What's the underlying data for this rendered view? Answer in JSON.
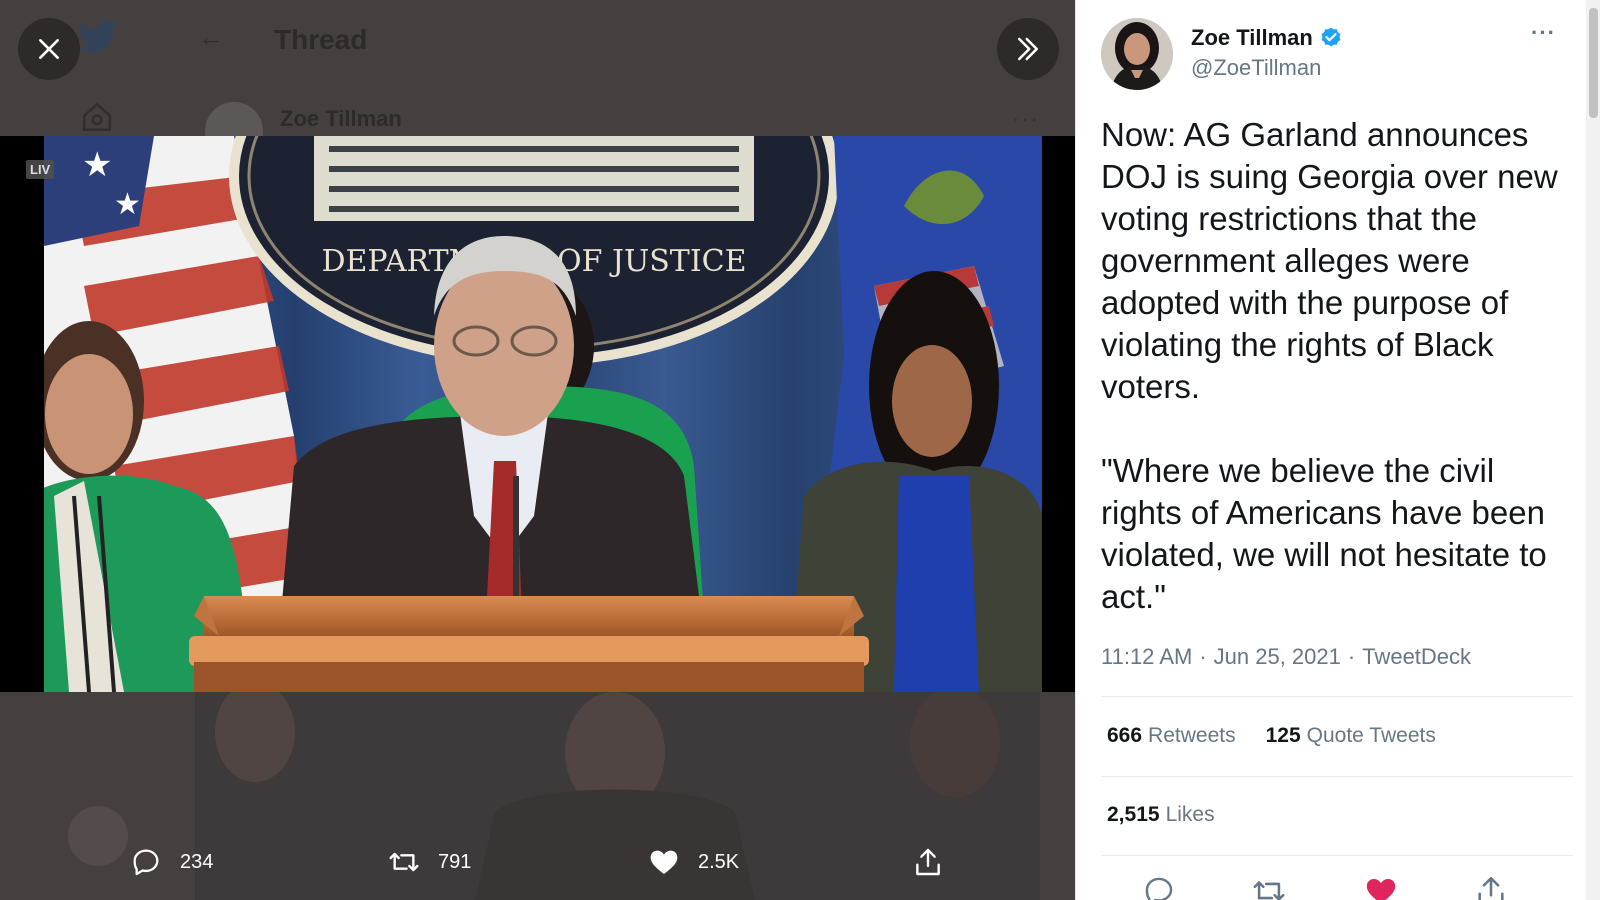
{
  "background_header": {
    "title": "Thread",
    "author_name": "Zoe Tillman"
  },
  "video": {
    "live_label": "LIV",
    "seal_text": "DEPARTMENT OF JUSTICE"
  },
  "media_actions": {
    "reply_count": "234",
    "retweet_count": "791",
    "like_count": "2.5K"
  },
  "tweet": {
    "author_name": "Zoe Tillman",
    "author_handle": "@ZoeTillman",
    "text": "Now: AG Garland announces DOJ is suing Georgia over new voting restrictions that the government alleges were adopted with the purpose of violating the rights of Black voters.\n\n\"Where we believe the civil rights of Americans have been violated, we will not hesitate to act.\"",
    "time": "11:12 AM",
    "date": "Jun 25, 2021",
    "source": "TweetDeck",
    "separator": "·",
    "retweets_count": "666",
    "retweets_label": "Retweets",
    "quote_count": "125",
    "quote_label": "Quote Tweets",
    "likes_count": "2,515",
    "likes_label": "Likes"
  },
  "colors": {
    "viewer_bg": "#463f3f",
    "verified_blue": "#1da1f2",
    "like_red": "#e0245e",
    "muted_text": "#657786"
  },
  "icons": [
    "close-icon",
    "chevrons-right-icon",
    "reply-icon",
    "retweet-icon",
    "heart-icon",
    "share-icon",
    "verified-icon",
    "more-icon"
  ]
}
